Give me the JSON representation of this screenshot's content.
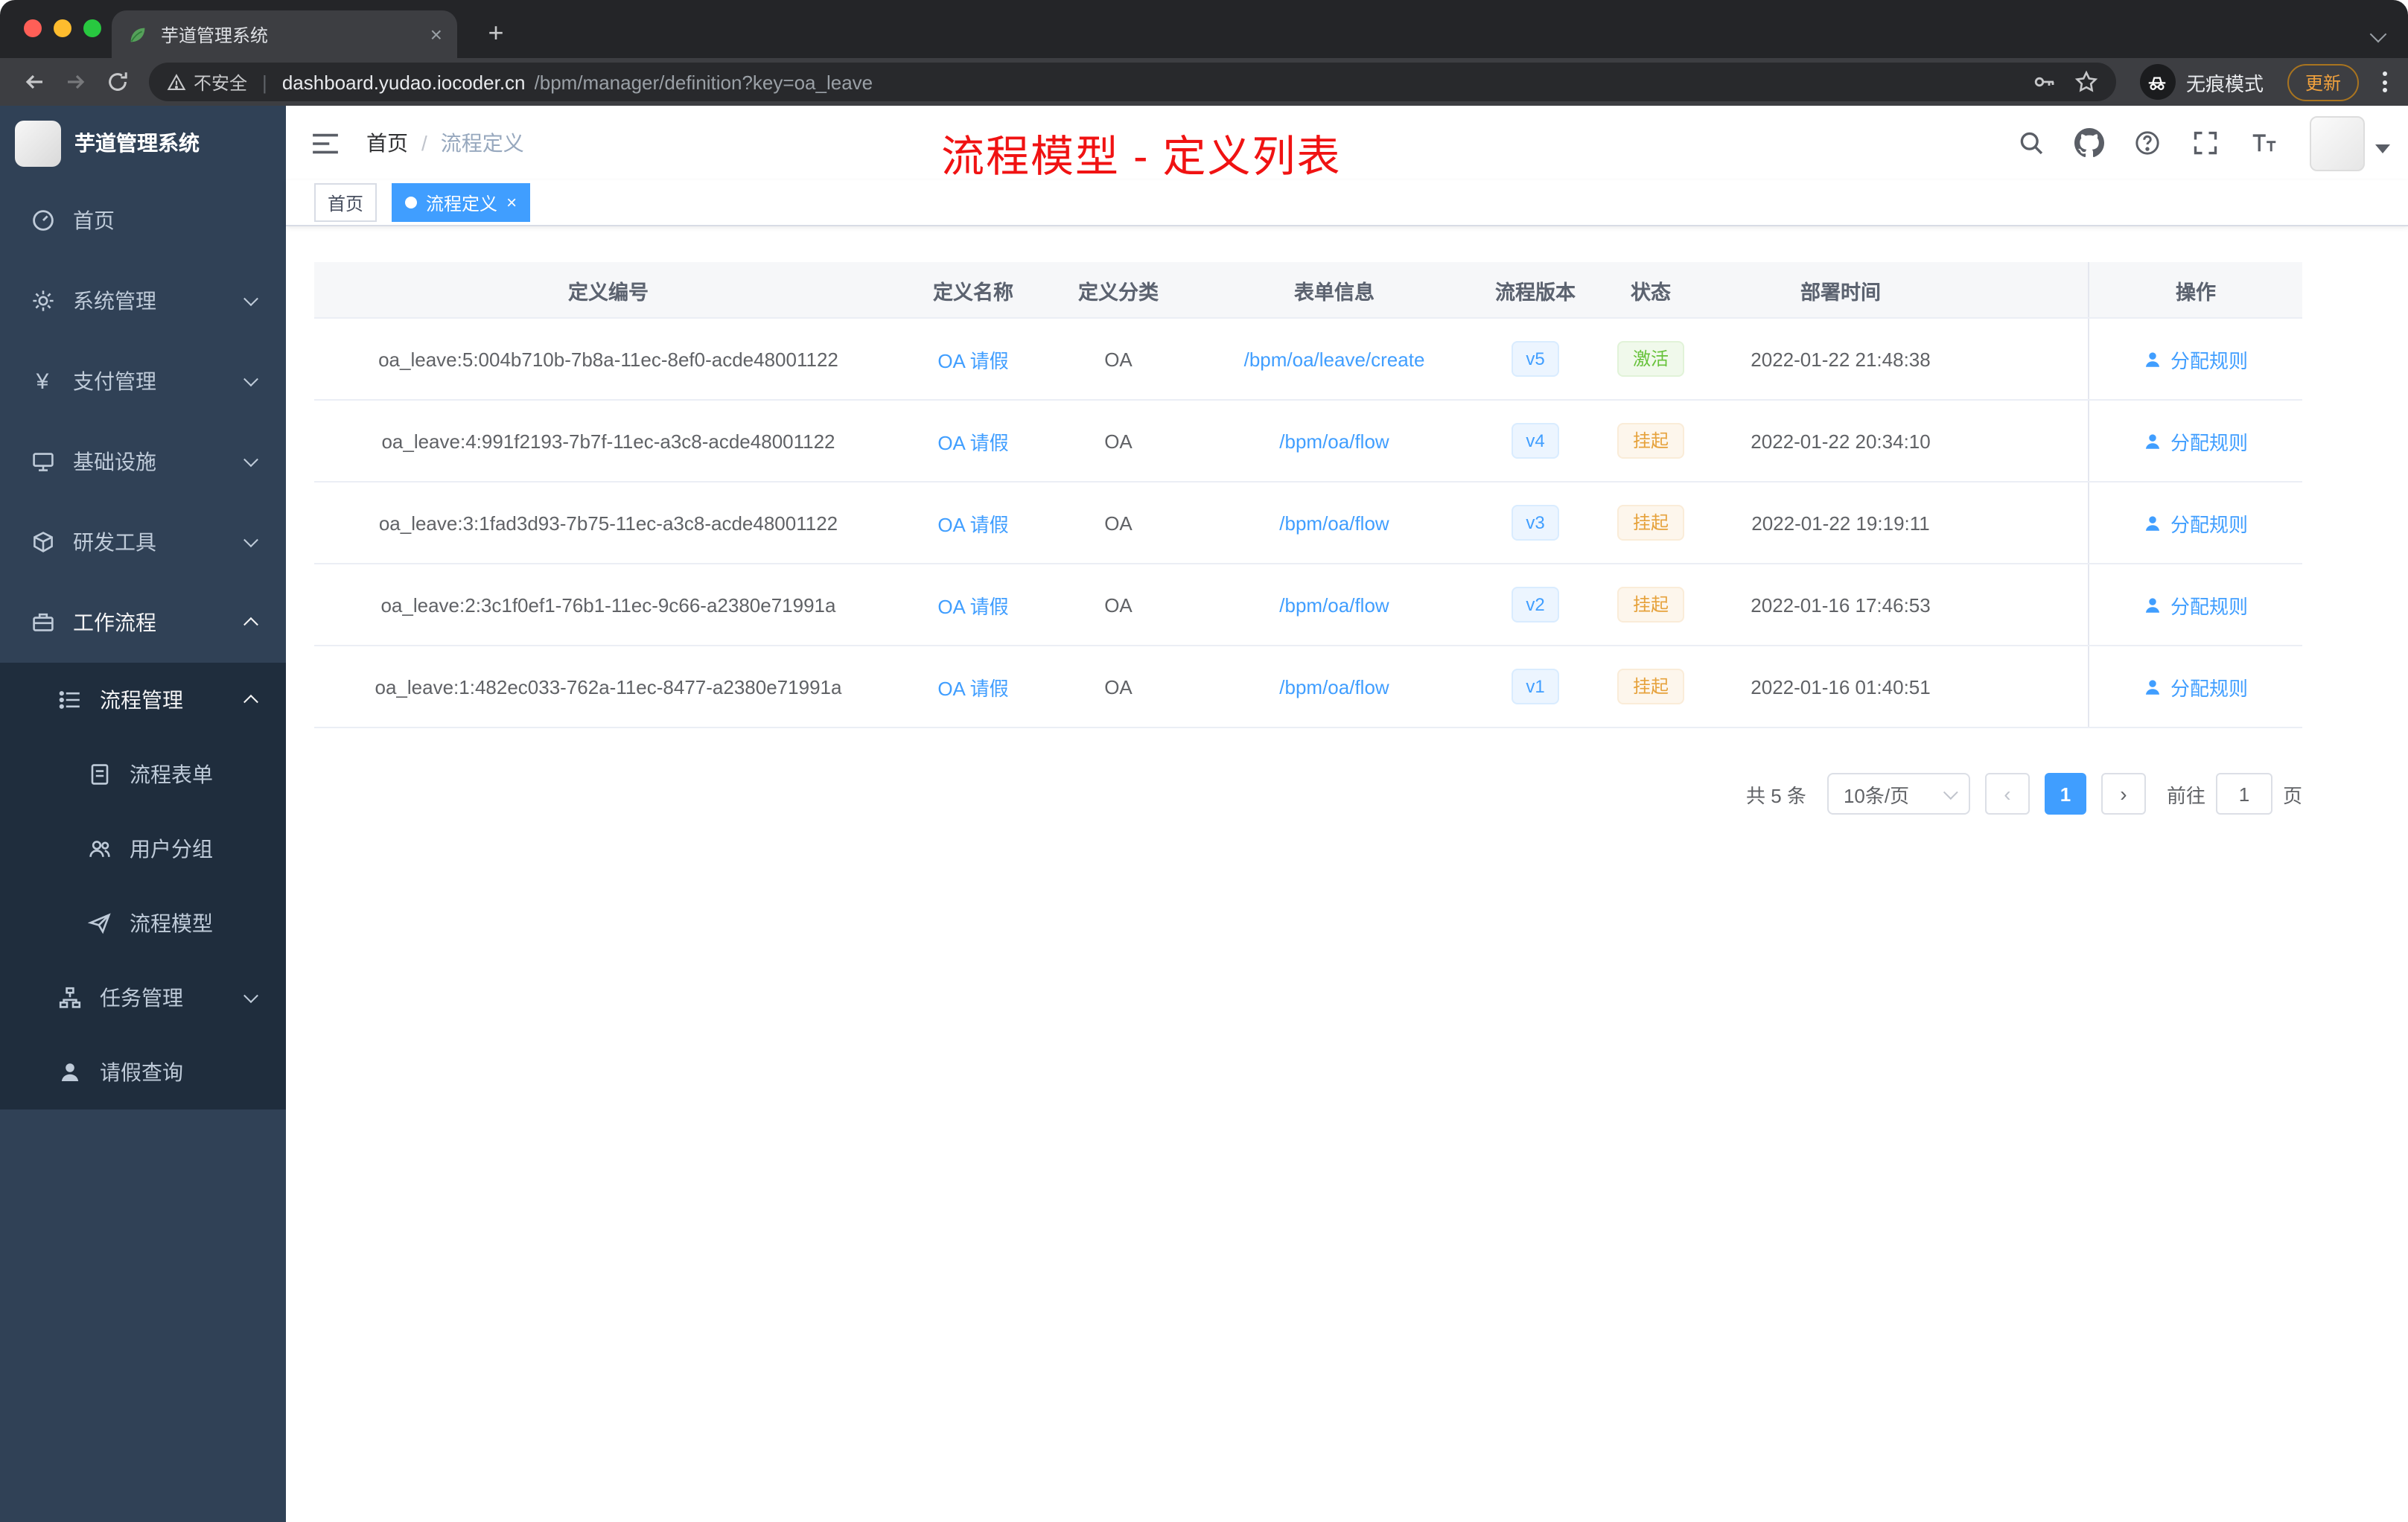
{
  "browser": {
    "tab_title": "芋道管理系统",
    "security_label": "不安全",
    "url_host": "dashboard.yudao.iocoder.cn",
    "url_path": "/bpm/manager/definition?key=oa_leave",
    "incognito_label": "无痕模式",
    "update_label": "更新"
  },
  "sidebar": {
    "logo_title": "芋道管理系统",
    "items": [
      {
        "label": "首页"
      },
      {
        "label": "系统管理"
      },
      {
        "label": "支付管理"
      },
      {
        "label": "基础设施"
      },
      {
        "label": "研发工具"
      },
      {
        "label": "工作流程"
      },
      {
        "label": "流程管理"
      },
      {
        "label": "流程表单"
      },
      {
        "label": "用户分组"
      },
      {
        "label": "流程模型"
      },
      {
        "label": "任务管理"
      },
      {
        "label": "请假查询"
      }
    ]
  },
  "header": {
    "breadcrumb_home": "首页",
    "breadcrumb_separator": "/",
    "breadcrumb_current": "流程定义",
    "overlay_title": "流程模型 - 定义列表"
  },
  "tags": {
    "home": "首页",
    "active": "流程定义"
  },
  "table": {
    "columns": [
      "定义编号",
      "定义名称",
      "定义分类",
      "表单信息",
      "流程版本",
      "状态",
      "部署时间",
      "操作"
    ],
    "action_label": "分配规则",
    "rows": [
      {
        "id": "oa_leave:5:004b710b-7b8a-11ec-8ef0-acde48001122",
        "name": "OA 请假",
        "category": "OA",
        "form": "/bpm/oa/leave/create",
        "version": "v5",
        "status": "激活",
        "time": "2022-01-22 21:48:38"
      },
      {
        "id": "oa_leave:4:991f2193-7b7f-11ec-a3c8-acde48001122",
        "name": "OA 请假",
        "category": "OA",
        "form": "/bpm/oa/flow",
        "version": "v4",
        "status": "挂起",
        "time": "2022-01-22 20:34:10"
      },
      {
        "id": "oa_leave:3:1fad3d93-7b75-11ec-a3c8-acde48001122",
        "name": "OA 请假",
        "category": "OA",
        "form": "/bpm/oa/flow",
        "version": "v3",
        "status": "挂起",
        "time": "2022-01-22 19:19:11"
      },
      {
        "id": "oa_leave:2:3c1f0ef1-76b1-11ec-9c66-a2380e71991a",
        "name": "OA 请假",
        "category": "OA",
        "form": "/bpm/oa/flow",
        "version": "v2",
        "status": "挂起",
        "time": "2022-01-16 17:46:53"
      },
      {
        "id": "oa_leave:1:482ec033-762a-11ec-8477-a2380e71991a",
        "name": "OA 请假",
        "category": "OA",
        "form": "/bpm/oa/flow",
        "version": "v1",
        "status": "挂起",
        "time": "2022-01-16 01:40:51"
      }
    ]
  },
  "pagination": {
    "total": "共 5 条",
    "page_size": "10条/页",
    "current_page": "1",
    "goto_label": "前往",
    "goto_value": "1",
    "goto_suffix": "页"
  },
  "colors": {
    "accent": "#409eff",
    "success": "#67c23a",
    "warning": "#e6a23c",
    "annotation_red": "#f01212",
    "sidebar_bg": "#304156",
    "submenu_bg": "#1f2d3d"
  }
}
